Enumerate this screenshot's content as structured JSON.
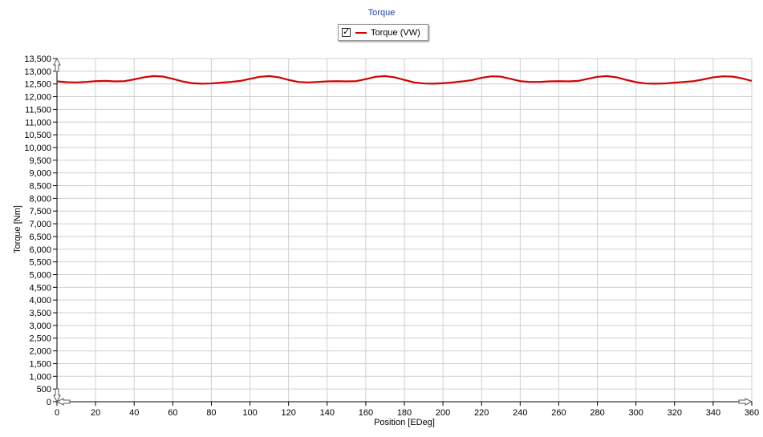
{
  "chart_data": {
    "type": "line",
    "title": "Torque",
    "xlabel": "Position [EDeg]",
    "ylabel": "Torque [Nm]",
    "xlim": [
      0,
      360
    ],
    "ylim": [
      0,
      13500
    ],
    "x_ticks": [
      "0",
      "20",
      "40",
      "60",
      "80",
      "100",
      "120",
      "140",
      "160",
      "180",
      "200",
      "220",
      "240",
      "260",
      "280",
      "300",
      "320",
      "340",
      "360"
    ],
    "y_ticks": [
      "0",
      "500",
      "1,000",
      "1,500",
      "2,000",
      "2,500",
      "3,000",
      "3,500",
      "4,000",
      "4,500",
      "5,000",
      "5,500",
      "6,000",
      "6,500",
      "7,000",
      "7,500",
      "8,000",
      "8,500",
      "9,000",
      "9,500",
      "10,000",
      "10,500",
      "11,000",
      "11,500",
      "12,000",
      "12,500",
      "13,000",
      "13,500"
    ],
    "grid": true,
    "legend_position": "top-center",
    "legend": {
      "checked": true,
      "check_mark": "✓"
    },
    "series": [
      {
        "name": "Torque (VW)",
        "color": "#d00000",
        "x": [
          0,
          5,
          10,
          15,
          20,
          25,
          30,
          35,
          40,
          45,
          50,
          55,
          60,
          65,
          70,
          75,
          80,
          85,
          90,
          95,
          100,
          105,
          110,
          115,
          120,
          125,
          130,
          135,
          140,
          145,
          150,
          155,
          160,
          165,
          170,
          175,
          180,
          185,
          190,
          195,
          200,
          205,
          210,
          215,
          220,
          225,
          230,
          235,
          240,
          245,
          250,
          255,
          260,
          265,
          270,
          275,
          280,
          285,
          290,
          295,
          300,
          305,
          310,
          315,
          320,
          325,
          330,
          335,
          340,
          345,
          350,
          355,
          360
        ],
        "y": [
          12600,
          12570,
          12560,
          12580,
          12610,
          12620,
          12600,
          12610,
          12680,
          12760,
          12810,
          12790,
          12700,
          12600,
          12530,
          12510,
          12520,
          12550,
          12580,
          12620,
          12700,
          12780,
          12810,
          12760,
          12660,
          12580,
          12560,
          12580,
          12600,
          12610,
          12600,
          12610,
          12690,
          12780,
          12810,
          12760,
          12660,
          12560,
          12520,
          12510,
          12530,
          12560,
          12600,
          12650,
          12740,
          12800,
          12790,
          12700,
          12610,
          12580,
          12580,
          12600,
          12610,
          12600,
          12620,
          12700,
          12780,
          12810,
          12760,
          12660,
          12570,
          12520,
          12510,
          12520,
          12550,
          12580,
          12610,
          12680,
          12760,
          12800,
          12790,
          12720,
          12620
        ]
      }
    ]
  }
}
